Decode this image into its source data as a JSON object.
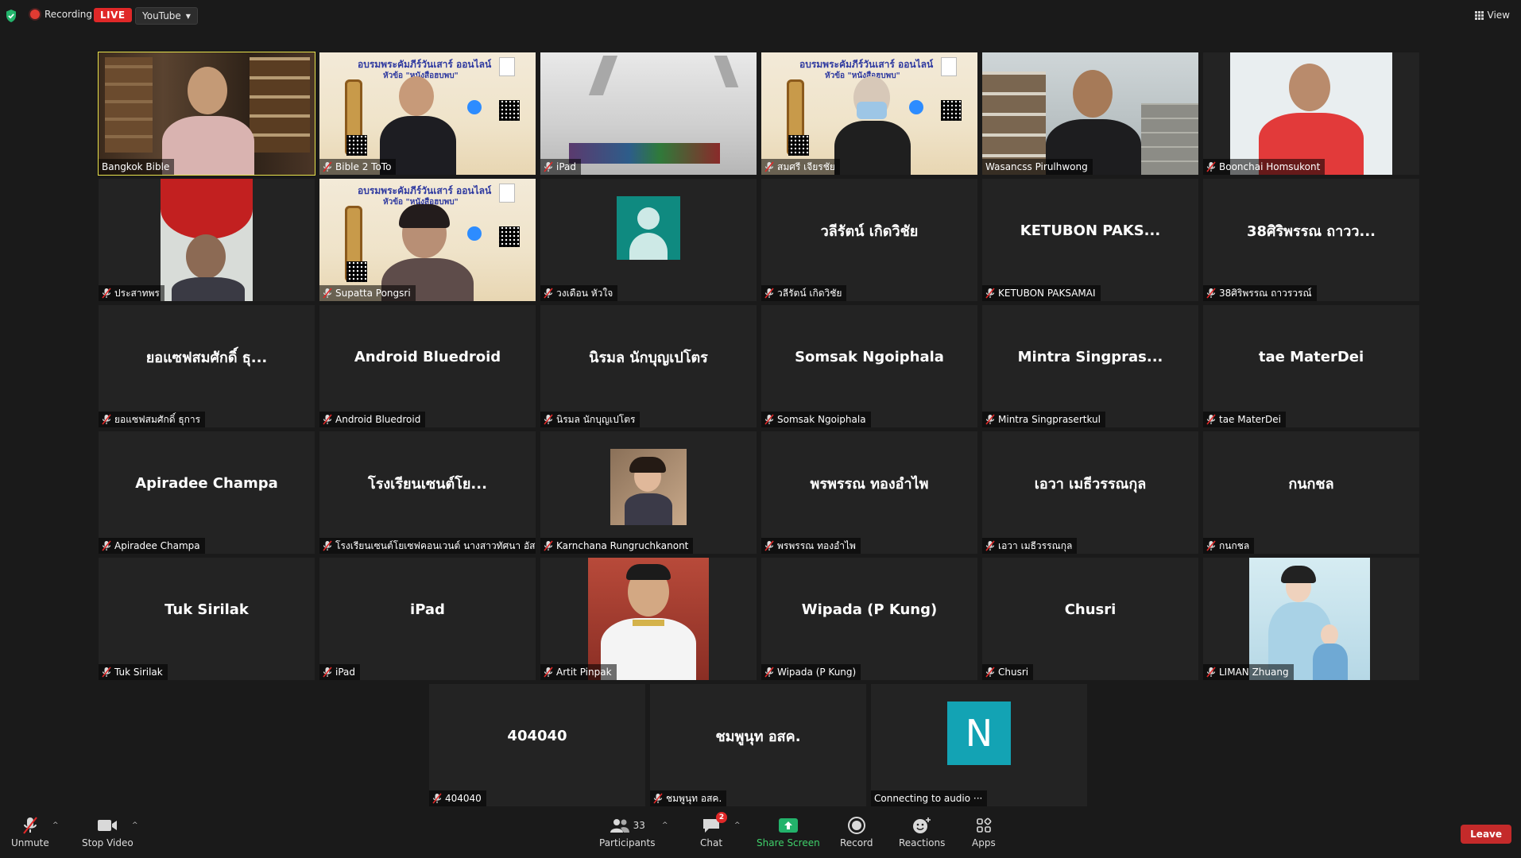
{
  "topbar": {
    "recording_label": "Recording",
    "live_label": "LIVE",
    "stream_target": "YouTube",
    "view_label": "View"
  },
  "tiles": [
    {
      "name": "Bangkok Bible",
      "display": "",
      "kind": "video-library",
      "active": true,
      "muted": false
    },
    {
      "name": "Bible 2 ToTo",
      "display": "",
      "kind": "poster-person",
      "muted": true
    },
    {
      "name": "iPad",
      "display": "",
      "kind": "video-room",
      "muted": true
    },
    {
      "name": "สมศรี เจียรชัย",
      "display": "",
      "kind": "poster-mask",
      "muted": true
    },
    {
      "name": "Wasancss Pirulhwong",
      "display": "",
      "kind": "video-priest",
      "muted": false
    },
    {
      "name": "Boonchai Homsukont",
      "display": "",
      "kind": "video-red",
      "muted": true
    },
    {
      "name": "ประสาทพร",
      "display": "",
      "kind": "video-umbrella",
      "muted": true
    },
    {
      "name": "Supatta Pongsri",
      "display": "",
      "kind": "poster-woman",
      "muted": true
    },
    {
      "name": "วงเดือน หัวใจ",
      "display": "",
      "kind": "avatar-default",
      "muted": true
    },
    {
      "name": "วลีรัตน์ เกิดวิชัย",
      "display": "วลีรัตน์ เกิดวิชัย",
      "kind": "name",
      "muted": true
    },
    {
      "name": "KETUBON PAKSAMAI",
      "display": "KETUBON PAKS...",
      "kind": "name",
      "muted": true
    },
    {
      "name": "38ศิริพรรณ ถาวรวรณ์",
      "display": "38ศิริพรรณ ถาวว...",
      "kind": "name",
      "muted": true
    },
    {
      "name": "ยอแซฟสมศักดิ์ ธุการ",
      "display": "ยอแซฟสมศักดิ์ ธุ...",
      "kind": "name",
      "muted": true
    },
    {
      "name": "Android Bluedroid",
      "display": "Android Bluedroid",
      "kind": "name",
      "muted": true
    },
    {
      "name": "นิรมล นักบุญเปโตร",
      "display": "นิรมล นักบุญเปโตร",
      "kind": "name",
      "muted": true
    },
    {
      "name": "Somsak Ngoiphala",
      "display": "Somsak Ngoiphala",
      "kind": "name",
      "muted": true
    },
    {
      "name": "Mintra Singprasertkul",
      "display": "Mintra Singpras...",
      "kind": "name",
      "muted": true
    },
    {
      "name": "tae MaterDei",
      "display": "tae MaterDei",
      "kind": "name",
      "muted": true
    },
    {
      "name": "Apiradee Champa",
      "display": "Apiradee Champa",
      "kind": "name",
      "muted": true
    },
    {
      "name": "โรงเรียนเซนต์โยเซฟคอนเวนต์ นางสาวทัศนา อัส...",
      "display": "โรงเรียนเซนต์โย...",
      "kind": "name",
      "muted": true
    },
    {
      "name": "Karnchana Rungruchkanont",
      "display": "",
      "kind": "photo-woman",
      "muted": true
    },
    {
      "name": "พรพรรณ ทองอำไพ",
      "display": "พรพรรณ ทองอำไพ",
      "kind": "name",
      "muted": true
    },
    {
      "name": "เอวา เมธีวรรณกุล",
      "display": "เอวา เมธีวรรณกุล",
      "kind": "name",
      "muted": true
    },
    {
      "name": "กนกชล",
      "display": "กนกชล",
      "kind": "name",
      "muted": true
    },
    {
      "name": "Tuk Sirilak",
      "display": "Tuk Sirilak",
      "kind": "name",
      "muted": true
    },
    {
      "name": "iPad",
      "display": "iPad",
      "kind": "name",
      "muted": true
    },
    {
      "name": "Artit Pinpak",
      "display": "",
      "kind": "photo-officer",
      "muted": true
    },
    {
      "name": "Wipada (P Kung)",
      "display": "Wipada (P Kung)",
      "kind": "name",
      "muted": true
    },
    {
      "name": "Chusri",
      "display": "Chusri",
      "kind": "name",
      "muted": true
    },
    {
      "name": "LIMAN Zhuang",
      "display": "",
      "kind": "photo-blue",
      "muted": true
    },
    {
      "name": "404040",
      "display": "404040",
      "kind": "name",
      "muted": true
    },
    {
      "name": "ชมพูนุท อสค.",
      "display": "ชมพูนุท อสค.",
      "kind": "name",
      "muted": true
    },
    {
      "name": "Connecting to audio ···",
      "display": "",
      "kind": "avatar-n",
      "avatar_letter": "N",
      "muted": false
    }
  ],
  "poster": {
    "title": "อบรมพระคัมภีร์วันเสาร์ ออนไลน์",
    "subtitle": "หัวข้อ \"หนังสือฮบพบ\""
  },
  "toolbar": {
    "unmute": "Unmute",
    "stop_video": "Stop Video",
    "participants": "Participants",
    "participants_count": "33",
    "chat": "Chat",
    "chat_badge": "2",
    "share_screen": "Share Screen",
    "record": "Record",
    "reactions": "Reactions",
    "apps": "Apps",
    "leave": "Leave"
  },
  "colors": {
    "active_speaker": "#e8e34d",
    "live_red": "#e02828",
    "share_green": "#3fd06a",
    "avatar_teal": "#0f8a80",
    "avatar_n": "#13a3b4"
  }
}
